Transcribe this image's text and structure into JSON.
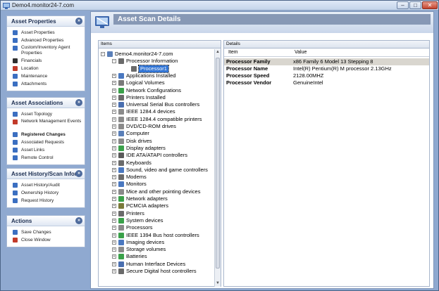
{
  "window": {
    "title": "Demo4.monitor24-7.com",
    "min_label": "–",
    "max_label": "□",
    "close_label": "✕"
  },
  "sidebar": {
    "panels": [
      {
        "title": "Asset Properties",
        "items": [
          {
            "label": "Asset Properties",
            "icon": "asset-properties-icon",
            "color": "#3b6fc1"
          },
          {
            "label": "Advanced Properties",
            "icon": "advanced-properties-icon",
            "color": "#3b6fc1"
          },
          {
            "label": "Custom/Inventory Agent Properties",
            "icon": "agent-properties-icon",
            "color": "#3b6fc1"
          },
          {
            "label": "Financials",
            "icon": "financials-icon",
            "color": "#2f2f2f"
          },
          {
            "label": "Location",
            "icon": "location-icon",
            "color": "#c23a2a"
          },
          {
            "label": "Maintenance",
            "icon": "maintenance-icon",
            "color": "#3b6fc1"
          },
          {
            "label": "Attachments",
            "icon": "attachments-icon",
            "color": "#3b6fc1"
          }
        ]
      },
      {
        "title": "Asset Associations",
        "items": [
          {
            "label": "Asset Topology",
            "icon": "topology-icon",
            "color": "#3b6fc1"
          },
          {
            "label": "Network Management Events",
            "icon": "events-icon",
            "color": "#c23a2a"
          },
          {
            "label": "Registered Changes",
            "icon": "changes-icon",
            "color": "#3b6fc1"
          },
          {
            "label": "Associated Requests",
            "icon": "requests-icon",
            "color": "#3b6fc1"
          },
          {
            "label": "Asset Links",
            "icon": "links-icon",
            "color": "#3b6fc1"
          },
          {
            "label": "Remote Control",
            "icon": "remote-control-icon",
            "color": "#3b6fc1"
          }
        ]
      },
      {
        "title": "Asset History/Scan Infor...",
        "items": [
          {
            "label": "Asset History/Audit",
            "icon": "history-icon",
            "color": "#3b6fc1"
          },
          {
            "label": "Ownership History",
            "icon": "ownership-icon",
            "color": "#3b6fc1"
          },
          {
            "label": "Request History",
            "icon": "request-history-icon",
            "color": "#3b6fc1"
          }
        ]
      },
      {
        "title": "Actions",
        "items": [
          {
            "label": "Save Changes",
            "icon": "save-icon",
            "color": "#3b6fc1"
          },
          {
            "label": "Close Window",
            "icon": "close-window-icon",
            "color": "#c23a2a"
          }
        ]
      }
    ]
  },
  "main": {
    "title": "Asset Scan Details",
    "items_label": "Items",
    "details_label": "Details",
    "tree": [
      {
        "label": "Demo4.monitor24-7.com",
        "depth": 0,
        "expander": "−",
        "icon": "computer-icon",
        "color": "#5a7fb8"
      },
      {
        "label": "Processor Information",
        "depth": 1,
        "expander": "−",
        "icon": "processor-icon",
        "color": "#6a6a6a"
      },
      {
        "label": "Processor1",
        "depth": 2,
        "expander": "",
        "icon": "cpu-icon",
        "color": "#6a6a6a",
        "selected": true
      },
      {
        "label": "Applications Installed",
        "depth": 1,
        "expander": "+",
        "icon": "applications-icon",
        "color": "#4a78c0"
      },
      {
        "label": "Logical Volumes",
        "depth": 1,
        "expander": "+",
        "icon": "volumes-icon",
        "color": "#7a7a7a"
      },
      {
        "label": "Network Configurations",
        "depth": 1,
        "expander": "+",
        "icon": "network-icon",
        "color": "#3aa14a"
      },
      {
        "label": "Printers Installed",
        "depth": 1,
        "expander": "+",
        "icon": "printer-icon",
        "color": "#6a6a6a"
      },
      {
        "label": "Universal Serial Bus controllers",
        "depth": 1,
        "expander": "+",
        "icon": "usb-icon",
        "color": "#4a6fb0"
      },
      {
        "label": "IEEE 1284.4 devices",
        "depth": 1,
        "expander": "+",
        "icon": "ieee-device-icon",
        "color": "#8a8a8a"
      },
      {
        "label": "IEEE 1284.4 compatible printers",
        "depth": 1,
        "expander": "+",
        "icon": "ieee-printer-icon",
        "color": "#8a8a8a"
      },
      {
        "label": "DVD/CD-ROM drives",
        "depth": 1,
        "expander": "+",
        "icon": "dvd-icon",
        "color": "#8a8a8a"
      },
      {
        "label": "Computer",
        "depth": 1,
        "expander": "+",
        "icon": "computer-node-icon",
        "color": "#5a7fb8"
      },
      {
        "label": "Disk drives",
        "depth": 1,
        "expander": "+",
        "icon": "disk-icon",
        "color": "#8a8a8a"
      },
      {
        "label": "Display adapters",
        "depth": 1,
        "expander": "+",
        "icon": "display-icon",
        "color": "#3aa14a"
      },
      {
        "label": "IDE ATA/ATAPI controllers",
        "depth": 1,
        "expander": "+",
        "icon": "ide-icon",
        "color": "#5a5a5a"
      },
      {
        "label": "Keyboards",
        "depth": 1,
        "expander": "+",
        "icon": "keyboard-icon",
        "color": "#6a6a6a"
      },
      {
        "label": "Sound, video and game controllers",
        "depth": 1,
        "expander": "+",
        "icon": "sound-icon",
        "color": "#4a78c0"
      },
      {
        "label": "Modems",
        "depth": 1,
        "expander": "+",
        "icon": "modem-icon",
        "color": "#6a6a6a"
      },
      {
        "label": "Monitors",
        "depth": 1,
        "expander": "+",
        "icon": "monitor-icon",
        "color": "#4a78c0"
      },
      {
        "label": "Mice and other pointing devices",
        "depth": 1,
        "expander": "+",
        "icon": "mouse-icon",
        "color": "#8a8a8a"
      },
      {
        "label": "Network adapters",
        "depth": 1,
        "expander": "+",
        "icon": "network-adapter-icon",
        "color": "#3aa14a"
      },
      {
        "label": "PCMCIA adapters",
        "depth": 1,
        "expander": "+",
        "icon": "pcmcia-icon",
        "color": "#7a7a3a"
      },
      {
        "label": "Printers",
        "depth": 1,
        "expander": "+",
        "icon": "printers-icon",
        "color": "#6a6a6a"
      },
      {
        "label": "System devices",
        "depth": 1,
        "expander": "+",
        "icon": "system-icon",
        "color": "#3aa14a"
      },
      {
        "label": "Processors",
        "depth": 1,
        "expander": "+",
        "icon": "processors-icon",
        "color": "#8a8a8a"
      },
      {
        "label": "IEEE 1394 Bus host controllers",
        "depth": 1,
        "expander": "+",
        "icon": "firewire-icon",
        "color": "#3aa14a"
      },
      {
        "label": "Imaging devices",
        "depth": 1,
        "expander": "+",
        "icon": "imaging-icon",
        "color": "#4a78c0"
      },
      {
        "label": "Storage volumes",
        "depth": 1,
        "expander": "+",
        "icon": "storage-icon",
        "color": "#8a8a8a"
      },
      {
        "label": "Batteries",
        "depth": 1,
        "expander": "+",
        "icon": "battery-icon",
        "color": "#3aa14a"
      },
      {
        "label": "Human Interface Devices",
        "depth": 1,
        "expander": "+",
        "icon": "hid-icon",
        "color": "#4a6fb0"
      },
      {
        "label": "Secure Digital host controllers",
        "depth": 1,
        "expander": "+",
        "icon": "sd-icon",
        "color": "#6a6a6a"
      }
    ],
    "details": {
      "col_item": "Item",
      "col_value": "Value",
      "rows": [
        {
          "item": "Processor Family",
          "value": "x86 Family 6 Model 13 Stepping 8",
          "selected": true
        },
        {
          "item": "Processor Name",
          "value": "Intel(R) Pentium(R) M processor 2.13GHz"
        },
        {
          "item": "Processor Speed",
          "value": "2128.00MHZ"
        },
        {
          "item": "Processor Vendor",
          "value": "GenuineIntel"
        }
      ]
    }
  },
  "colors": {
    "accent": "#3174d4",
    "title_bar_band": "#8798b5",
    "panel_header_text": "#1d2f52"
  }
}
